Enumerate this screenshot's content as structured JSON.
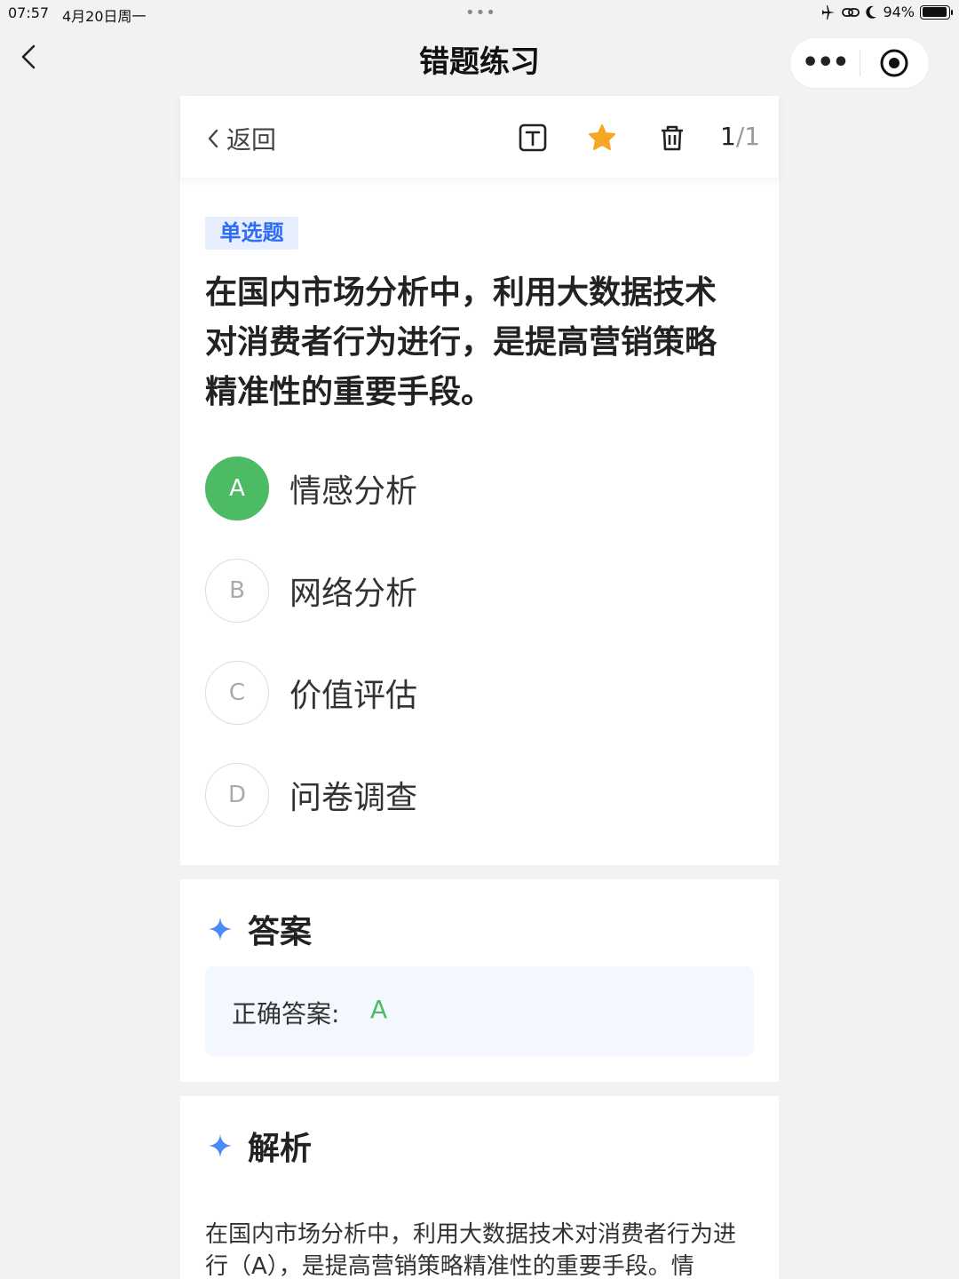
{
  "status_bar": {
    "time": "07:57",
    "date": "4月20日周一",
    "battery": "94%"
  },
  "nav": {
    "title": "错题练习"
  },
  "toolbar": {
    "back_label": "返回",
    "current": "1",
    "total": "/1"
  },
  "question": {
    "type": "单选题",
    "text": "在国内市场分析中，利用大数据技术对消费者行为进行，是提高营销策略精准性的重要手段。",
    "options": [
      {
        "letter": "A",
        "text": "情感分析",
        "correct": true
      },
      {
        "letter": "B",
        "text": "网络分析",
        "correct": false
      },
      {
        "letter": "C",
        "text": "价值评估",
        "correct": false
      },
      {
        "letter": "D",
        "text": "问卷调查",
        "correct": false
      }
    ]
  },
  "answer": {
    "heading": "答案",
    "label": "正确答案:",
    "value": "A"
  },
  "analysis": {
    "heading": "解析",
    "text": "在国内市场分析中，利用大数据技术对消费者行为进行（A），是提高营销策略精准性的重要手段。情"
  },
  "colors": {
    "correct": "#4cbb63",
    "accent": "#2f6cf0",
    "star": "#f5a623"
  }
}
